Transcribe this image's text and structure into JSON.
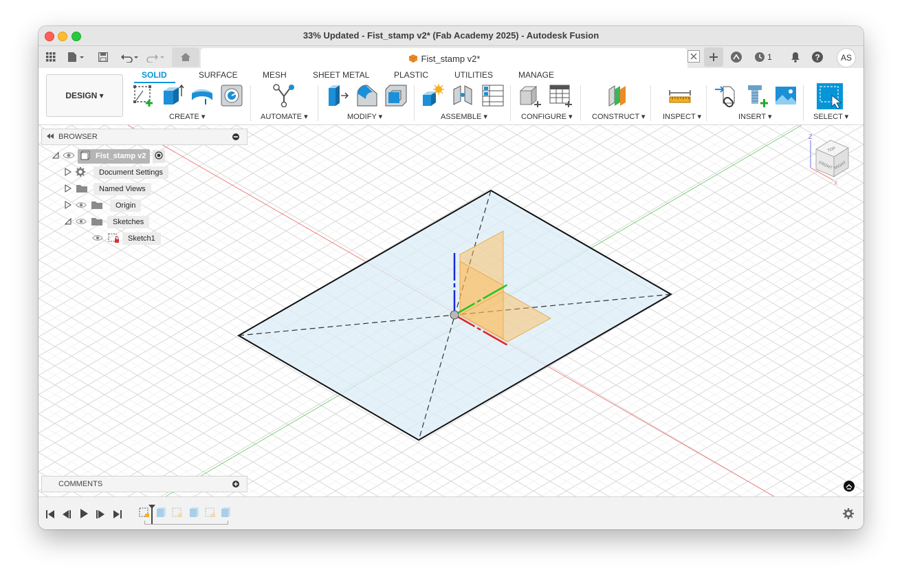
{
  "window": {
    "title": "33% Updated - Fist_stamp v2* (Fab Academy 2025) - Autodesk Fusion"
  },
  "doc_tab": {
    "name": "Fist_stamp v2*"
  },
  "qat": {
    "job_count": "1",
    "user_initials": "AS"
  },
  "workspace": {
    "label": "DESIGN ▾"
  },
  "ribbon_tabs": [
    "SOLID",
    "SURFACE",
    "MESH",
    "SHEET METAL",
    "PLASTIC",
    "UTILITIES",
    "MANAGE"
  ],
  "groups": {
    "create": "CREATE ▾",
    "automate": "AUTOMATE ▾",
    "modify": "MODIFY ▾",
    "assemble": "ASSEMBLE ▾",
    "configure": "CONFIGURE ▾",
    "construct": "CONSTRUCT ▾",
    "inspect": "INSPECT ▾",
    "insert": "INSERT ▾",
    "select": "SELECT ▾"
  },
  "browser": {
    "title": "BROWSER",
    "root": "Fist_stamp v2",
    "items": [
      "Document Settings",
      "Named Views",
      "Origin",
      "Sketches",
      "Sketch1"
    ]
  },
  "comments": {
    "title": "COMMENTS"
  },
  "viewcube": {
    "top": "TOP",
    "front": "FRONT",
    "right": "RIGHT",
    "axis_z": "Z",
    "axis_x": "X"
  },
  "colors": {
    "accent": "#0696d7",
    "plane_fill": "#ffb74d",
    "sketch_fill": "#dcecf7"
  }
}
